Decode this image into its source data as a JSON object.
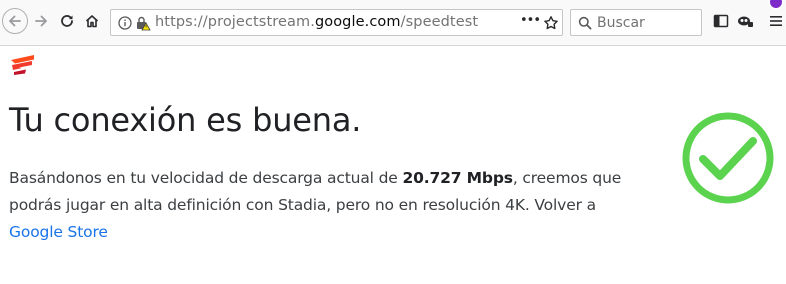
{
  "browser": {
    "url_prefix": "https://projectstream.",
    "url_host": "google.com",
    "url_path": "/speedtest",
    "search_placeholder": "Buscar",
    "page_actions_label": "•••"
  },
  "page": {
    "headline": "Tu conexión es buena.",
    "text_before_speed": "Basándonos en tu velocidad de descarga actual de ",
    "speed": "20.727 Mbps",
    "text_after_speed": ", creemos que podrás jugar en alta definición con Stadia, pero no en resolución 4K. Volver a ",
    "store_link": "Google Store",
    "status_icon": "checkmark-circle-icon"
  },
  "colors": {
    "check_green": "#5bd34f",
    "link_blue": "#1a73e8"
  }
}
